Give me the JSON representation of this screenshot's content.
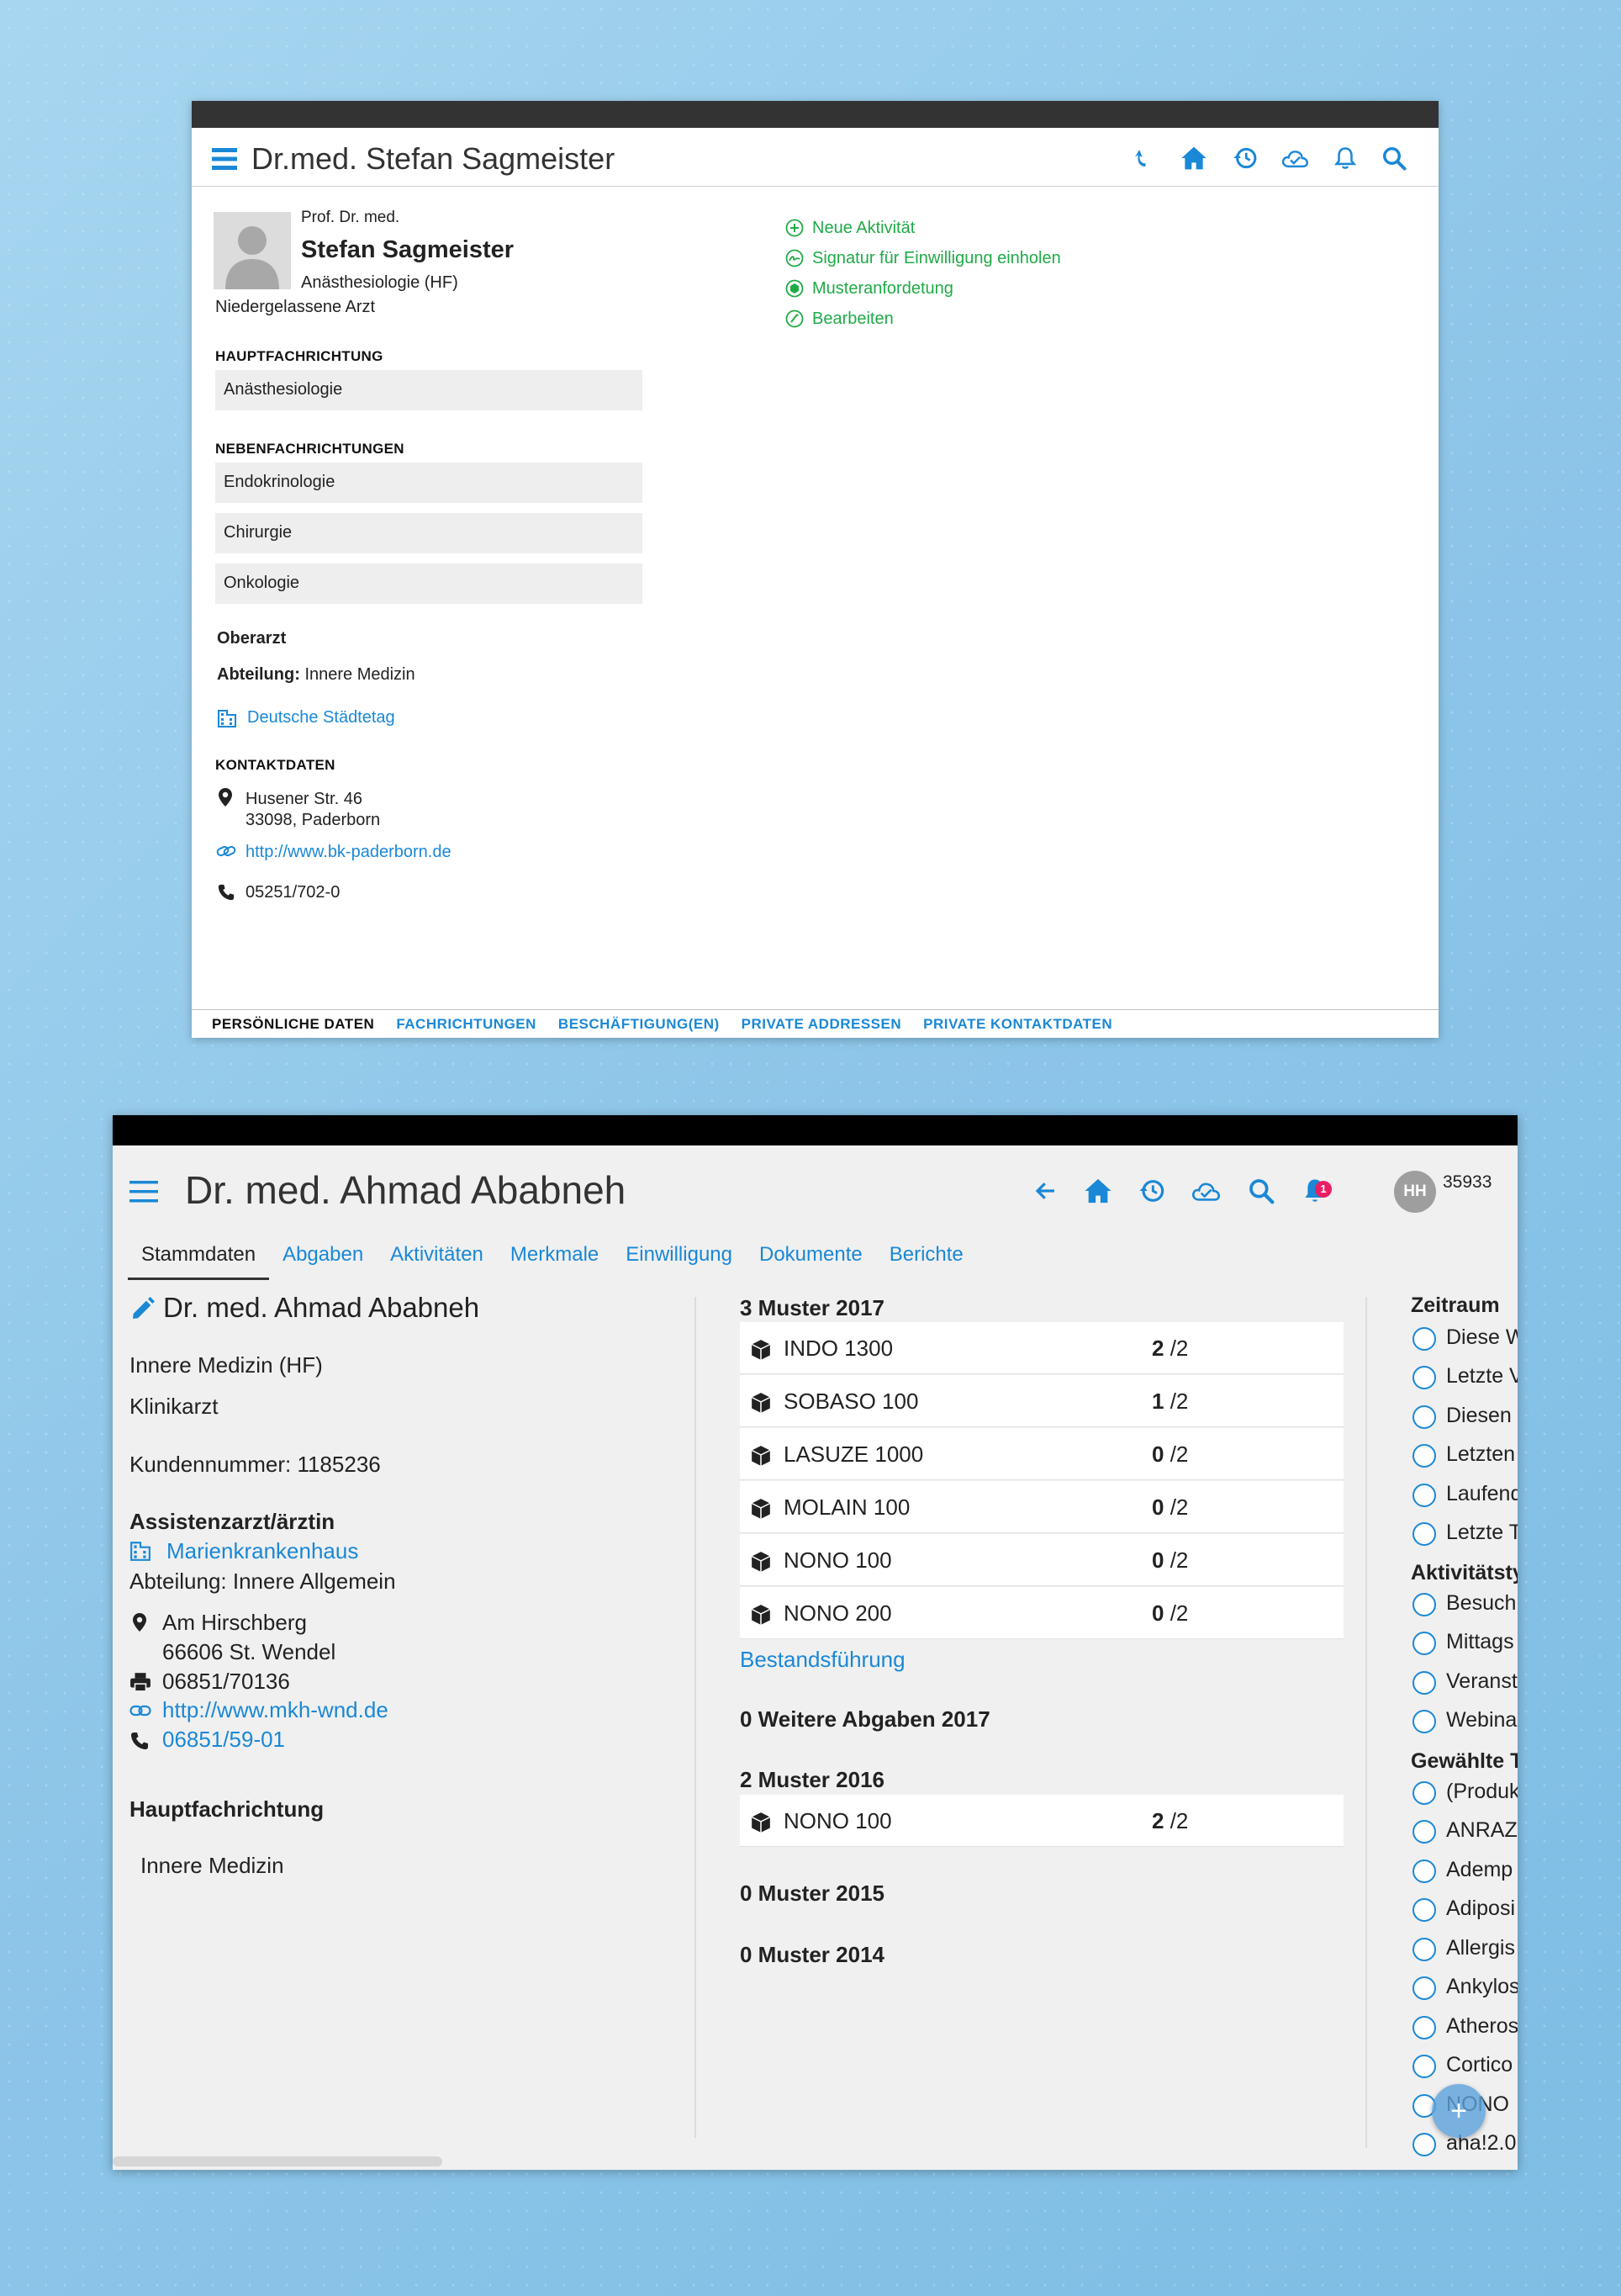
{
  "window1": {
    "title": "Dr.med. Stefan Sagmeister",
    "header_icons": [
      "undo-icon",
      "home-icon",
      "history-icon",
      "cloud-check-icon",
      "bell-icon",
      "search-icon"
    ],
    "profile": {
      "honorific": "Prof. Dr. med.",
      "name": "Stefan Sagmeister",
      "specialty": "Anästhesiologie (HF)",
      "role": "Niedergelassene Arzt"
    },
    "hauptfachrichtung": {
      "label": "HAUPTFACHRICHTUNG",
      "value": "Anästhesiologie"
    },
    "nebenfachrichtungen": {
      "label": "NEBENFACHRICHTUNGEN",
      "items": [
        "Endokrinologie",
        "Chirurgie",
        "Onkologie"
      ]
    },
    "position": "Oberarzt",
    "abteilung": {
      "label": "Abteilung:",
      "value": "Innere Medizin"
    },
    "organization": "Deutsche Städtetag",
    "contact": {
      "label": "KONTAKTDATEN",
      "street": "Husener Str. 46",
      "city": "33098, Paderborn",
      "url": "http://www.bk-paderborn.de",
      "phone": "05251/702-0"
    },
    "actions": [
      "Neue Aktivität",
      "Signatur für Einwilligung einholen",
      "Musteranfordetung",
      "Bearbeiten"
    ],
    "footer_tabs": [
      "PERSÖNLICHE DATEN",
      "FACHRICHTUNGEN",
      "BESCHÄFTIGUNG(EN)",
      "PRIVATE ADDRESSEN",
      "PRIVATE KONTAKTDATEN"
    ],
    "colors": {
      "accent": "#1a88d6",
      "action_green": "#1faa47",
      "topbar": "#333333"
    }
  },
  "window2": {
    "title": "Dr. med. Ahmad Ababneh",
    "header_icons": [
      "arrow-back-icon",
      "home-icon",
      "history-icon",
      "cloud-check-icon",
      "search-icon",
      "bell-icon"
    ],
    "notification_count": "1",
    "user_initials": "HH",
    "user_id": "35933",
    "tabs": [
      "Stammdaten",
      "Abgaben",
      "Aktivitäten",
      "Merkmale",
      "Einwilligung",
      "Dokumente",
      "Berichte"
    ],
    "active_tab": "Stammdaten",
    "left": {
      "name": "Dr. med. Ahmad Ababneh",
      "specialty": "Innere Medizin (HF)",
      "role": "Klinikarzt",
      "customer_number": "Kundennummer: 1185236",
      "position": "Assistenzarzt/ärztin",
      "organization": "Marienkrankenhaus",
      "abteilung": "Abteilung: Innere Allgemein",
      "street": "Am Hirschberg",
      "city": "66606 St. Wendel",
      "fax": "06851/70136",
      "url": "http://www.mkh-wnd.de",
      "phone": "06851/59-01",
      "hauptfachrichtung_label": "Hauptfachrichtung",
      "hauptfachrichtung_value": "Innere Medizin"
    },
    "middle": {
      "group_2017": "3 Muster 2017",
      "items_2017": [
        {
          "name": "INDO 1300",
          "count": "2",
          "total": "/2"
        },
        {
          "name": "SOBASO 100",
          "count": "1",
          "total": "/2"
        },
        {
          "name": "LASUZE 1000",
          "count": "0",
          "total": "/2"
        },
        {
          "name": "MOLAIN 100",
          "count": "0",
          "total": "/2"
        },
        {
          "name": "NONO 100",
          "count": "0",
          "total": "/2"
        },
        {
          "name": "NONO 200",
          "count": "0",
          "total": "/2"
        }
      ],
      "bestand_link": "Bestandsführung",
      "weitere": "0 Weitere Abgaben 2017",
      "group_2016": "2 Muster 2016",
      "items_2016": [
        {
          "name": "NONO 100",
          "count": "2",
          "total": "/2"
        }
      ],
      "group_2015": "0 Muster 2015",
      "group_2014": "0 Muster 2014"
    },
    "right": {
      "zeitraum_label": "Zeitraum",
      "zeitraum": [
        "Diese W",
        "Letzte V",
        "Diesen",
        "Letzten",
        "Laufend",
        "Letzte T"
      ],
      "aktivitaet_label": "Aktivitätsty",
      "aktivitaet": [
        "Besuch",
        "Mittags",
        "Veranst",
        "Webina"
      ],
      "gewaehlt_label": "Gewählte T",
      "gewaehlt": [
        "(Produk",
        "ANRAZ",
        "Ademp",
        "Adiposi",
        "Allergis",
        "Ankylos",
        "Atheros",
        "Cortico",
        "NONO",
        "aha!2.0"
      ]
    },
    "fab_symbol": "+",
    "colors": {
      "accent": "#1a88d6",
      "badge": "#e91e63",
      "background": "#f0f0f0"
    }
  }
}
